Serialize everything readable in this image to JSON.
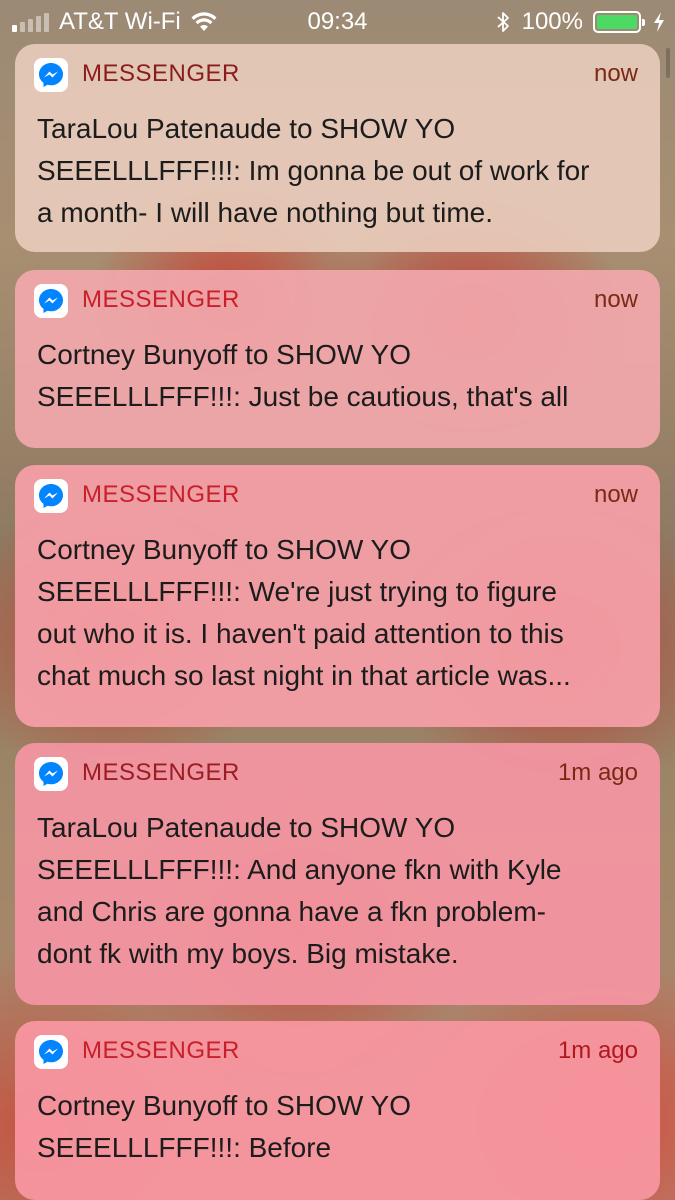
{
  "status_bar": {
    "carrier": "AT&T Wi-Fi",
    "time": "09:34",
    "battery_percent": "100%",
    "battery_level": 1.0,
    "battery_color": "#4cd964"
  },
  "notifications": [
    {
      "app": "MESSENGER",
      "time": "now",
      "lines": [
        "TaraLou Patenaude to SHOW YO",
        "SEEELLLFFF!!!: Im gonna be out of work for",
        "a month- I will have nothing but time."
      ]
    },
    {
      "app": "MESSENGER",
      "time": "now",
      "lines": [
        "Cortney Bunyoff to SHOW YO",
        "SEEELLLFFF!!!: Just be cautious, that's all"
      ]
    },
    {
      "app": "MESSENGER",
      "time": "now",
      "lines": [
        "Cortney Bunyoff to SHOW YO",
        "SEEELLLFFF!!!: We're just trying to figure",
        "out who it is.  I haven't paid attention to this",
        "chat much so last night in that article was..."
      ]
    },
    {
      "app": "MESSENGER",
      "time": "1m ago",
      "lines": [
        "TaraLou Patenaude to SHOW YO",
        "SEEELLLFFF!!!: And anyone fkn with Kyle",
        "and Chris are gonna have a fkn problem-",
        "dont fk with my boys.  Big mistake."
      ]
    },
    {
      "app": "MESSENGER",
      "time": "1m ago",
      "lines": [
        "Cortney Bunyoff to SHOW YO",
        "SEEELLLFFF!!!: Before"
      ]
    }
  ],
  "icons": {
    "app_icon": "messenger-icon",
    "wifi": "wifi-icon",
    "bluetooth": "bluetooth-icon",
    "charging": "charging-bolt-icon"
  },
  "colors": {
    "messenger_blue": "#0084ff",
    "app_name_red": "#c8202a"
  }
}
